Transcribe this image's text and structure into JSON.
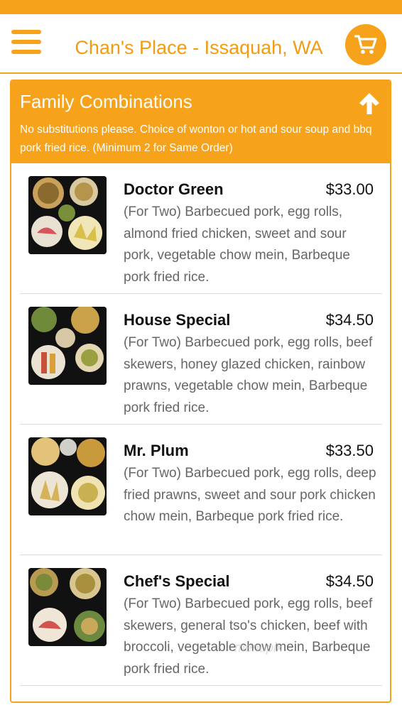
{
  "header": {
    "title": "Chan's Place - Issaquah, WA",
    "menu_icon": "hamburger-menu-icon",
    "cart_icon": "shopping-cart-icon"
  },
  "colors": {
    "accent": "#f7a21b",
    "title_text": "#f39c12",
    "item_name": "#111111",
    "item_desc": "#666666"
  },
  "section": {
    "title": "Family Combinations",
    "description": "No substitutions please. Choice of wonton or hot and sour soup and bbq pork fried rice. (Minimum 2 for Same Order)",
    "collapse_icon": "arrow-up-icon"
  },
  "items": [
    {
      "name": "Doctor Green",
      "price": "$33.00",
      "description": "(For Two) Barbecued pork, egg rolls, almond fried chicken, sweet and sour pork, vegetable chow mein, Barbeque pork fried rice."
    },
    {
      "name": "House Special",
      "price": "$34.50",
      "description": "(For Two) Barbecued pork, egg rolls, beef skewers, honey glazed chicken, rainbow prawns, vegetable chow mein, Barbeque pork fried rice."
    },
    {
      "name": "Mr. Plum",
      "price": "$33.50",
      "description": "(For Two) Barbecued pork, egg rolls, deep fried prawns, sweet and sour pork chicken chow mein, Barbeque pork fried rice."
    },
    {
      "name": "Chef's Special",
      "price": "$34.50",
      "description": "(For Two) Barbecued pork, egg rolls, beef skewers, general tso's chicken, beef with broccoli, vegetable chow mein, Barbeque pork fried rice."
    }
  ],
  "watermark": "menupix"
}
